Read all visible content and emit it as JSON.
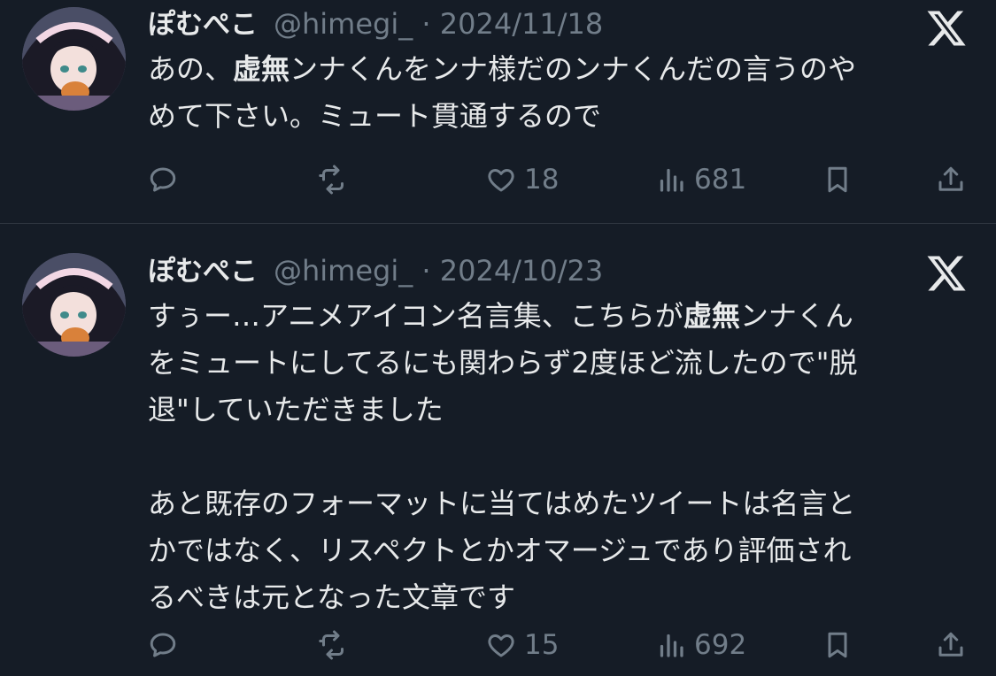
{
  "tweets": [
    {
      "display_name": "ぽむぺこ",
      "meta": "@himegi_ · 2024/11/18",
      "lines": [
        [
          {
            "t": "あの、"
          },
          {
            "t": "虚無",
            "b": true
          },
          {
            "t": "ンナくんをンナ様だのンナくんだの言うのや"
          }
        ],
        [
          {
            "t": "めて下さい。ミュート貫通するので"
          }
        ]
      ],
      "stats": {
        "replies": "",
        "retweets": "",
        "likes": "18",
        "views": "681"
      }
    },
    {
      "display_name": "ぽむぺこ",
      "meta": "@himegi_ · 2024/10/23",
      "lines": [
        [
          {
            "t": "すぅー…アニメアイコン名言集、こちらが"
          },
          {
            "t": "虚無",
            "b": true
          },
          {
            "t": "ンナくん"
          }
        ],
        [
          {
            "t": "をミュートにしてるにも関わらず2度ほど流したので\"脱"
          }
        ],
        [
          {
            "t": "退\"していただきました"
          }
        ],
        [],
        [
          {
            "t": "あと既存のフォーマットに当てはめたツイートは名言と"
          }
        ],
        [
          {
            "t": "かではなく、リスペクトとかオマージュであり評価され"
          }
        ],
        [
          {
            "t": "るべきは元となった文章です"
          }
        ]
      ],
      "stats": {
        "replies": "",
        "retweets": "",
        "likes": "15",
        "views": "692"
      }
    }
  ],
  "icons": {
    "reply": "speech-bubble-icon",
    "retweet": "retweet-arrows-icon",
    "like": "heart-icon",
    "views": "bar-chart-icon",
    "bookmark": "bookmark-icon",
    "share": "share-upload-icon",
    "brand": "x-logo-icon"
  },
  "colors": {
    "background": "#151c26",
    "text": "#e7e9ea",
    "muted": "#717d89",
    "divider": "#2f3640"
  }
}
